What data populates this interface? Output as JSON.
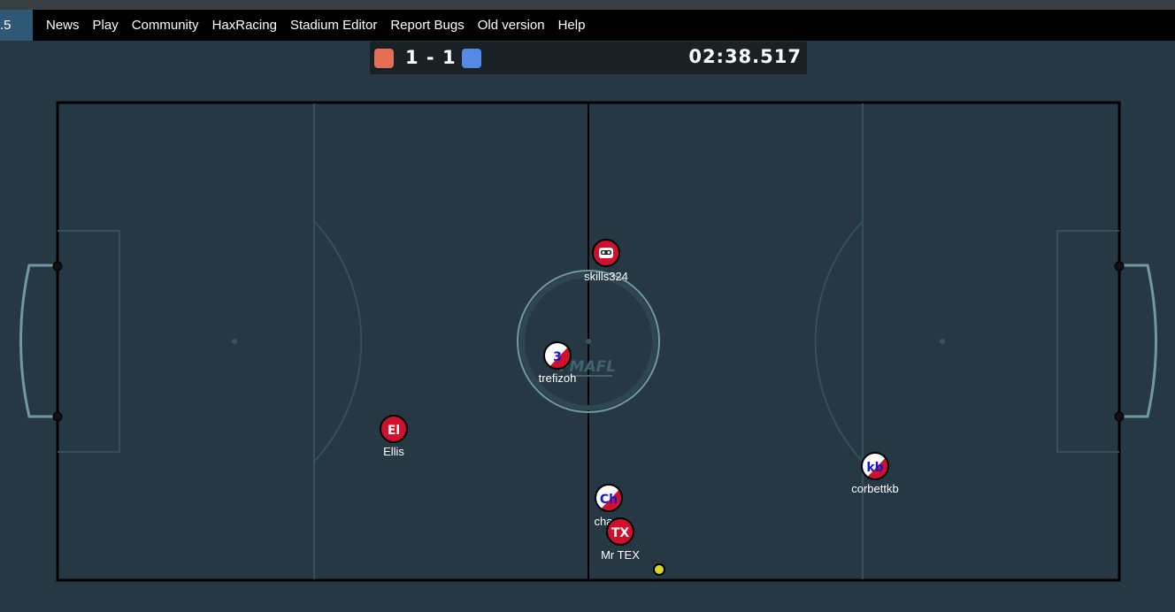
{
  "nav": {
    "version_badge": ".5",
    "items": [
      "News",
      "Play",
      "Community",
      "HaxRacing",
      "Stadium Editor",
      "Report Bugs",
      "Old version",
      "Help"
    ]
  },
  "scoreboard": {
    "score": "1 - 1",
    "timer": "02:38.517",
    "red_color": "#e56e56",
    "blue_color": "#5689e5"
  },
  "pitch": {
    "background": "#263843",
    "center_logo": "FMAFL"
  },
  "players": [
    {
      "name": "skills324",
      "avatar": "",
      "team": "red",
      "icon": "robot-face-icon"
    },
    {
      "name": "trefizoh",
      "avatar": "3",
      "team": "blue"
    },
    {
      "name": "Ellis",
      "avatar": "El",
      "team": "red"
    },
    {
      "name": "corbettkb",
      "avatar": "kb",
      "team": "blue"
    },
    {
      "name": "cha",
      "avatar": "Ch",
      "team": "blue"
    },
    {
      "name": "Mr TEX",
      "avatar": "TX",
      "team": "red"
    }
  ],
  "ball": {
    "color": "#d7d72a"
  }
}
